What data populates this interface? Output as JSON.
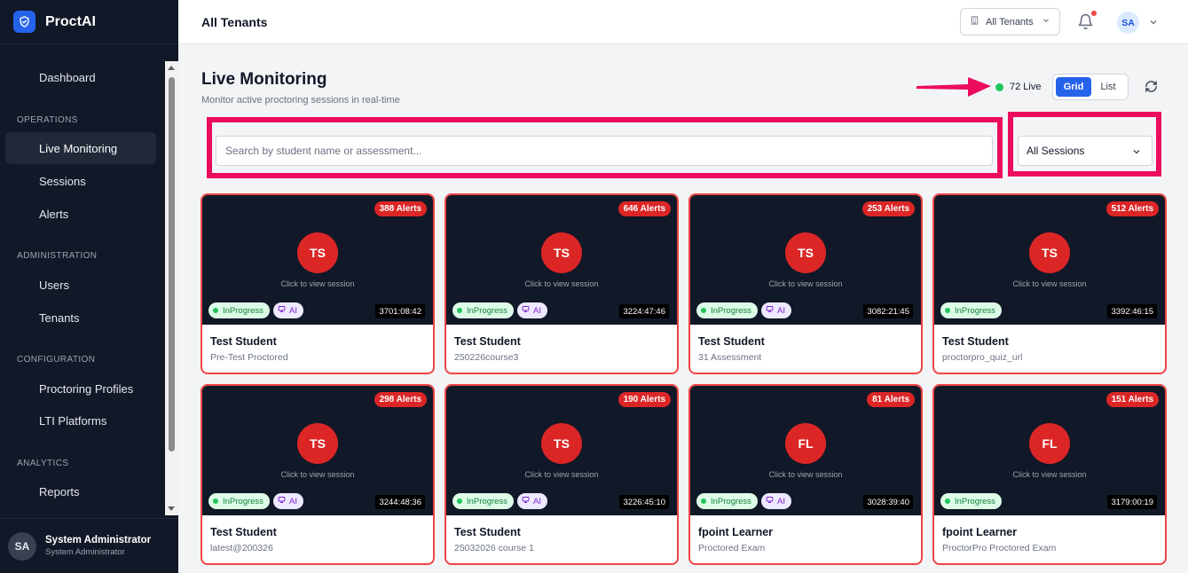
{
  "app": {
    "name": "ProctAI"
  },
  "sidebar": {
    "items": [
      {
        "label": "Dashboard"
      },
      {
        "label": "Live Monitoring",
        "active": true
      },
      {
        "label": "Sessions"
      },
      {
        "label": "Alerts"
      },
      {
        "label": "Users"
      },
      {
        "label": "Tenants"
      },
      {
        "label": "Proctoring Profiles"
      },
      {
        "label": "LTI Platforms"
      },
      {
        "label": "Reports"
      }
    ],
    "sections": [
      "OPERATIONS",
      "ADMINISTRATION",
      "CONFIGURATION",
      "ANALYTICS"
    ],
    "user": {
      "initials": "SA",
      "name": "System Administrator",
      "role": "System Administrator"
    }
  },
  "topbar": {
    "title": "All Tenants",
    "tenant_select": "All Tenants",
    "avatar_initials": "SA"
  },
  "page": {
    "title": "Live Monitoring",
    "subtitle": "Monitor active proctoring sessions in real-time",
    "live_count": "72 Live",
    "view_grid": "Grid",
    "view_list": "List",
    "search_placeholder": "Search by student name or assessment...",
    "filter_value": "All Sessions"
  },
  "cards": [
    {
      "alerts": "388 Alerts",
      "initials": "TS",
      "hint": "Click to view session",
      "status": "InProgress",
      "ai": "AI",
      "timer": "3701:08:42",
      "name": "Test Student",
      "exam": "Pre-Test Proctored"
    },
    {
      "alerts": "646 Alerts",
      "initials": "TS",
      "hint": "Click to view session",
      "status": "InProgress",
      "ai": "AI",
      "timer": "3224:47:46",
      "name": "Test Student",
      "exam": "250226course3"
    },
    {
      "alerts": "253 Alerts",
      "initials": "TS",
      "hint": "Click to view session",
      "status": "InProgress",
      "ai": "AI",
      "timer": "3082:21:45",
      "name": "Test Student",
      "exam": "31 Assessment"
    },
    {
      "alerts": "512 Alerts",
      "initials": "TS",
      "hint": "Click to view session",
      "status": "InProgress",
      "ai": null,
      "timer": "3392:46:15",
      "name": "Test Student",
      "exam": "proctorpro_quiz_url"
    },
    {
      "alerts": "298 Alerts",
      "initials": "TS",
      "hint": "Click to view session",
      "status": "InProgress",
      "ai": "AI",
      "timer": "3244:48:36",
      "name": "Test Student",
      "exam": "latest@200326"
    },
    {
      "alerts": "190 Alerts",
      "initials": "TS",
      "hint": "Click to view session",
      "status": "InProgress",
      "ai": "AI",
      "timer": "3226:45:10",
      "name": "Test Student",
      "exam": "25032026 course 1"
    },
    {
      "alerts": "81 Alerts",
      "initials": "FL",
      "hint": "Click to view session",
      "status": "InProgress",
      "ai": "AI",
      "timer": "3028:39:40",
      "name": "fpoint Learner",
      "exam": "Proctored Exam"
    },
    {
      "alerts": "151 Alerts",
      "initials": "FL",
      "hint": "Click to view session",
      "status": "InProgress",
      "ai": null,
      "timer": "3179:00:19",
      "name": "fpoint Learner",
      "exam": "ProctorPro Proctored Exam"
    }
  ],
  "colors": {
    "accent": "#2563eb",
    "alert": "#dc2626",
    "highlight": "#ec0c5e",
    "sidebar": "#111827"
  },
  "icons": {
    "brand": "shield-check-icon",
    "tenant": "building-icon",
    "notifications": "bell-icon",
    "refresh": "refresh-icon",
    "ai": "monitor-icon"
  }
}
